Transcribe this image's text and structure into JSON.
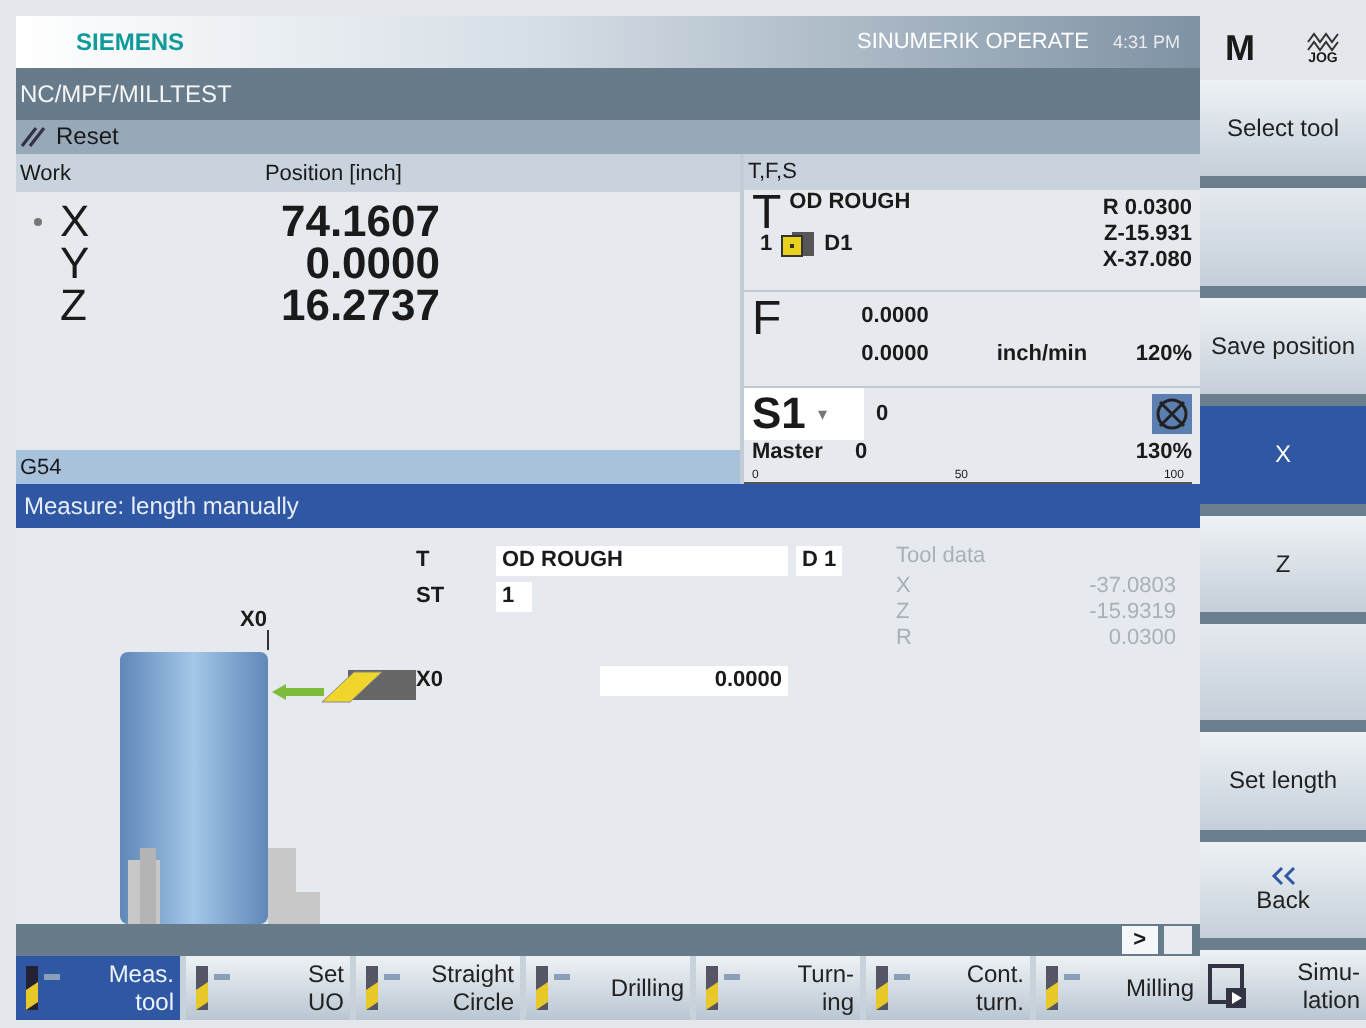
{
  "header": {
    "brand": "SIEMENS",
    "product": "SINUMERIK OPERATE",
    "time": "4:31 PM",
    "mode": "M",
    "mode_sub": "JOG"
  },
  "program_path": "NC/MPF/MILLTEST",
  "channel_status": "Reset",
  "position": {
    "col_work": "Work",
    "col_pos": "Position [inch]",
    "axes": [
      {
        "name": "X",
        "value": "74.1607",
        "active": true
      },
      {
        "name": "Y",
        "value": "0.0000",
        "active": false
      },
      {
        "name": "Z",
        "value": "16.2737",
        "active": false
      }
    ],
    "offset": "G54"
  },
  "tfs": {
    "title": "T,F,S",
    "tool_letter": "T",
    "tool_name": "OD ROUGH",
    "tool_no": "1",
    "edge": "D1",
    "radius": "R 0.0300",
    "z": "Z-15.931",
    "x": "X-37.080",
    "feed_letter": "F",
    "feed1": "0.0000",
    "feed2": "0.0000",
    "feed_unit": "inch/min",
    "feed_override": "120%",
    "spindle": "S1",
    "spindle_caret": "▾",
    "spindle_value": "0",
    "spindle_mode": "Master",
    "spindle_speed": "0",
    "spindle_override": "130%",
    "scale": [
      "0",
      "50",
      "100"
    ]
  },
  "measure": {
    "title": "Measure: length manually",
    "t_label": "T",
    "t_value": "OD ROUGH",
    "d_value": "D 1",
    "st_label": "ST",
    "st_value": "1",
    "x0_label": "X0",
    "x0_value": "0.0000",
    "drawing_label": "X0",
    "tool_data": {
      "title": "Tool data",
      "disabled": true,
      "rows": [
        {
          "label": "X",
          "value": "-37.0803"
        },
        {
          "label": "Z",
          "value": "-15.9319"
        },
        {
          "label": "R",
          "value": "0.0300"
        }
      ]
    }
  },
  "scroll_hint": ">",
  "vertical_softkeys": [
    {
      "label": "Select tool",
      "selected": false
    },
    {
      "kind": "empty"
    },
    {
      "label": "Save position",
      "selected": false
    },
    {
      "label": "X",
      "selected": true
    },
    {
      "label": "Z",
      "selected": false
    },
    {
      "kind": "empty"
    },
    {
      "label": "Set length",
      "selected": false
    },
    {
      "label": "Back",
      "selected": false,
      "kind": "back"
    }
  ],
  "horizontal_softkeys": [
    {
      "lines": [
        "Meas.",
        "tool"
      ],
      "selected": true
    },
    {
      "lines": [
        "Set",
        "UO"
      ],
      "selected": false
    },
    {
      "lines": [
        "Straight",
        "Circle"
      ],
      "selected": false
    },
    {
      "lines": [
        "Drilling"
      ],
      "selected": false
    },
    {
      "lines": [
        "Turn-",
        "ing"
      ],
      "selected": false
    },
    {
      "lines": [
        "Cont.",
        "turn."
      ],
      "selected": false
    },
    {
      "lines": [
        "Milling"
      ],
      "selected": false
    },
    {
      "lines": [
        "Simu-",
        "lation"
      ],
      "selected": false
    }
  ]
}
